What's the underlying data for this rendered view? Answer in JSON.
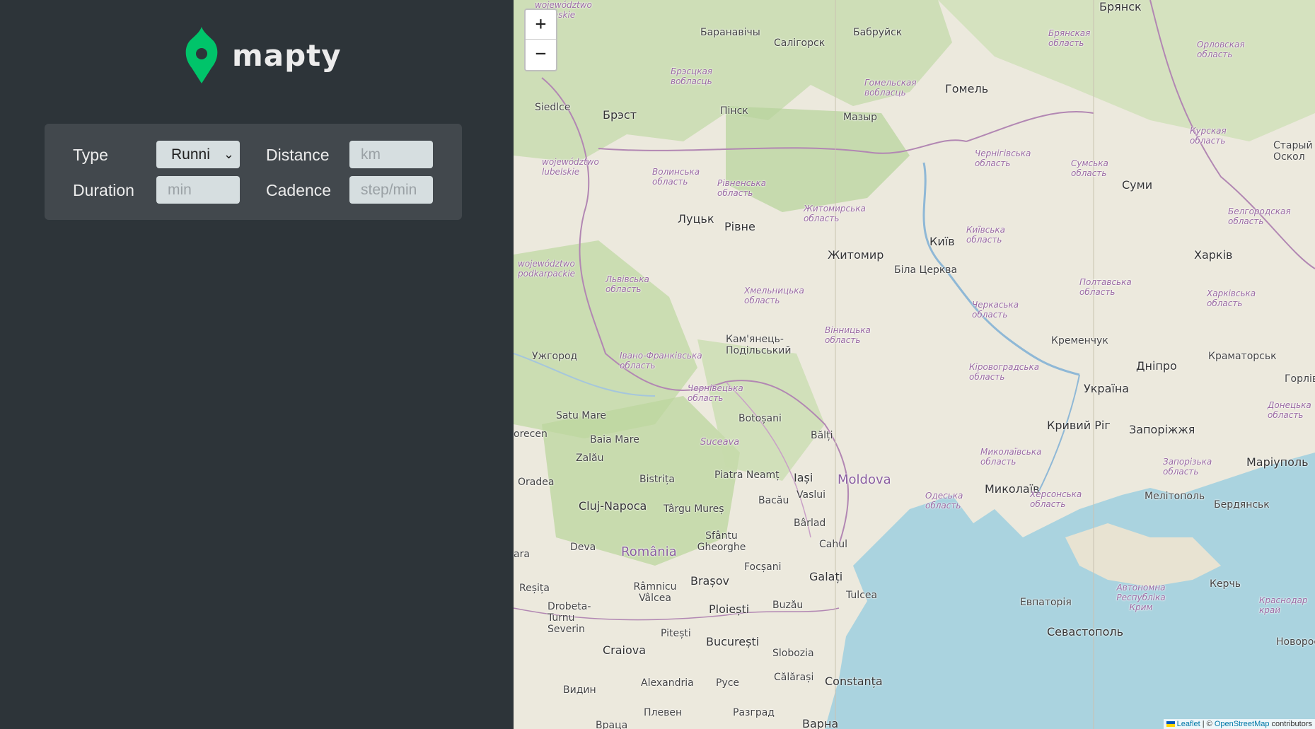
{
  "app": {
    "logo_text": "mapty"
  },
  "colors": {
    "brand_green": "#00c46a",
    "sidebar_bg": "#2d3439",
    "form_bg": "#42484d",
    "sea": "#aad3df"
  },
  "form": {
    "type_label": "Type",
    "type_value": "Runni",
    "distance_label": "Distance",
    "distance_placeholder": "km",
    "duration_label": "Duration",
    "duration_placeholder": "min",
    "cadence_label": "Cadence",
    "cadence_placeholder": "step/min"
  },
  "map": {
    "zoom_in": "+",
    "zoom_out": "−",
    "attribution_leaflet": "Leaflet",
    "attribution_sep": " | © ",
    "attribution_osm": "OpenStreetMap",
    "attribution_tail": " contributors",
    "places": {
      "bryansk": "Брянск",
      "baranavichy": "Баранавічы",
      "salihorsk": "Салігорск",
      "babruysk": "Бабруйск",
      "bryanskaya_obl": "Брянская область",
      "orlovskaya_obl": "Орловская область",
      "wojewodztwo_podlaskie": "województwo podlaskie",
      "brestskaya_obl": "Брэсцкая вобласць",
      "homelskaya_obl": "Гомельская вобласць",
      "homel": "Гомель",
      "siedlce": "Siedlce",
      "brest": "Брэст",
      "pinsk": "Пінск",
      "mazyr": "Мазыр",
      "kurskaya_obl": "Курская область",
      "stary_oskol": "Старый Оскол",
      "chernihivska_obl": "Чернігівська область",
      "sumska_obl": "Сумська область",
      "sumy": "Суми",
      "wojewodztwo_lubelskie": "województwo lubelskie",
      "volynska_obl": "Волинська область",
      "rivnenska_obl": "Рівненська область",
      "zhytomyrska_obl": "Житомирська область",
      "kyivska_obl": "Київська область",
      "belgorodskaya_obl": "Белгородская область",
      "lutsk": "Луцьк",
      "rivne": "Рівне",
      "kyiv": "Київ",
      "zhytomyr": "Житомир",
      "bila_tserkva": "Біла Церква",
      "kharkiv": "Харків",
      "wojewodztwo_podkarpackie": "województwo podkarpackie",
      "lvivska_obl": "Львівська область",
      "khmelnytska_obl": "Хмельницька область",
      "poltavska_obl": "Полтавська область",
      "kharkivska_obl": "Харківська область",
      "vinnytska_obl": "Вінницька область",
      "cherkaska_obl": "Черкаська область",
      "kremenchuk": "Кременчук",
      "kamianets": "Кам'янець-Подільський",
      "uzhhorod": "Ужгород",
      "ivano_frankivska_obl": "Івано-Франківська область",
      "kirovohradska_obl": "Кіровоградська область",
      "kramatorsk": "Краматорськ",
      "dnipro": "Дніпро",
      "horlivka": "Горлівк",
      "chernivetska_obl": "Чернівецька область",
      "ukraina": "Україна",
      "donetska_obl": "Донецька область",
      "satu_mare": "Satu Mare",
      "botosani": "Botoșani",
      "baia_mare": "Baia Mare",
      "suceava": "Suceava",
      "balti": "Bălți",
      "kryvyi_rih": "Кривий Ріг",
      "zaporizhzhia": "Запоріжжя",
      "orecen": "orecen",
      "zalau": "Zalău",
      "mykolaivska_obl": "Миколаївська область",
      "zaporizka_obl": "Запорізька область",
      "mariupol": "Маріуполь",
      "oradea": "Oradea",
      "bistrita": "Bistrița",
      "piatra_neamt": "Piatra Neamț",
      "iasi": "Iași",
      "moldova": "Moldova",
      "mykolaiv": "Миколаїв",
      "vaslui": "Vaslui",
      "cluj": "Cluj-Napoca",
      "bacau": "Bacău",
      "odeska_obl": "Одеська область",
      "khersonska_obl": "Херсонська область",
      "melitopol": "Мелітополь",
      "berdiansk": "Бердянськ",
      "targu_mures": "Târgu Mureș",
      "barlad": "Bârlad",
      "sfantu": "Sfântu Gheorghe",
      "deva": "Deva",
      "romania": "România",
      "cahul": "Cahul",
      "ara": "ara",
      "focsani": "Focșani",
      "brasov": "Brașov",
      "galati": "Galați",
      "resita": "Reșița",
      "rm_valcea": "Râmnicu Vâlcea",
      "tulcea": "Tulcea",
      "avtonomna": "Автономна Республіка Крим",
      "kerch": "Керчь",
      "yevpatoriia": "Евпаторія",
      "krasnodarskiy": "Краснодар край",
      "drobeta": "Drobeta-Turnu Severin",
      "ploiesti": "Ploiești",
      "buzau": "Buzău",
      "sevastopol": "Севастополь",
      "pitesti": "Pitești",
      "bucuresti": "București",
      "novorossiysk": "Новоросси",
      "craiova": "Craiova",
      "slobozia": "Slobozia",
      "calarasi": "Călărași",
      "constanta": "Constanța",
      "vidin": "Видин",
      "alexandria": "Alexandria",
      "ruse": "Русе",
      "pleven": "Плевен",
      "razgrad": "Разград",
      "vratsa": "Враца",
      "varna": "Варна"
    }
  }
}
